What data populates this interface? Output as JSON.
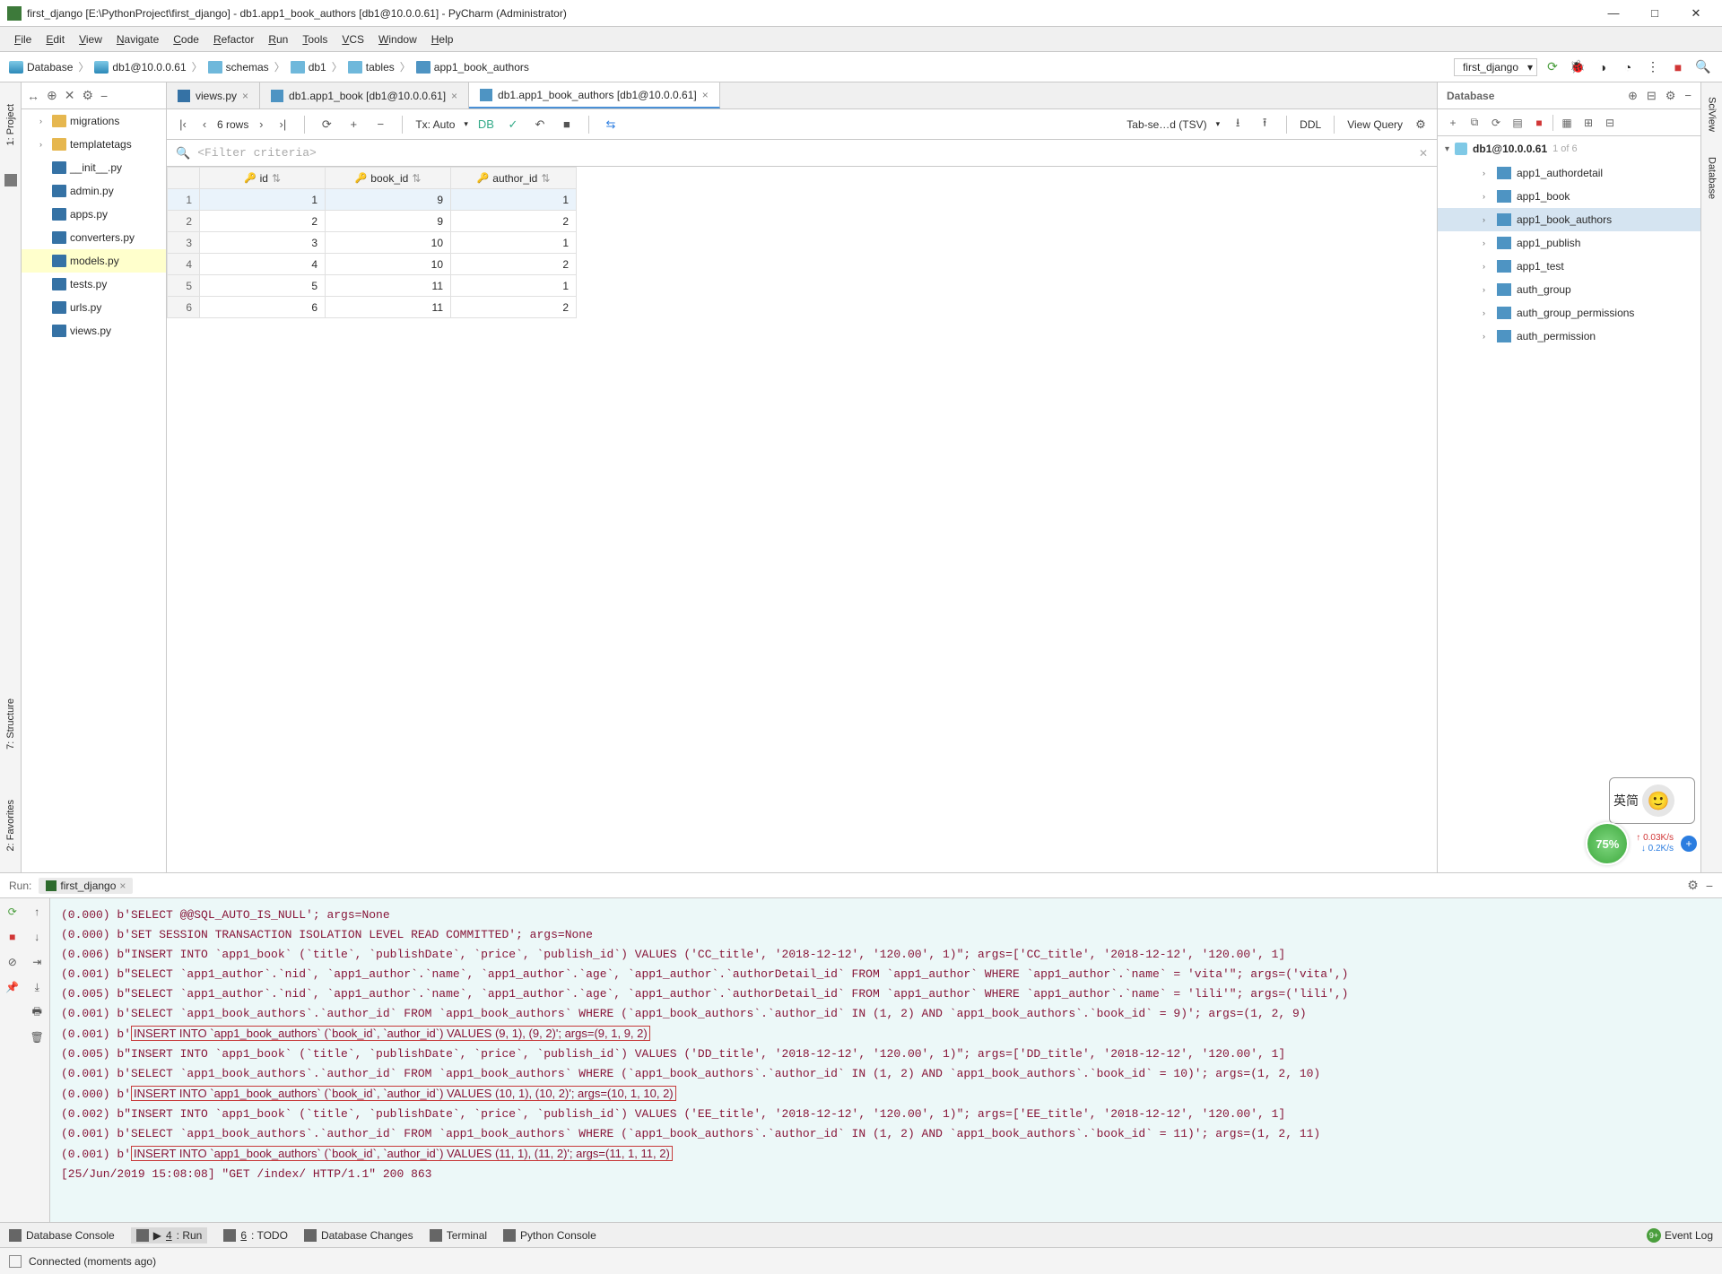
{
  "title": "first_django [E:\\PythonProject\\first_django] - db1.app1_book_authors [db1@10.0.0.61] - PyCharm (Administrator)",
  "menu": [
    "File",
    "Edit",
    "View",
    "Navigate",
    "Code",
    "Refactor",
    "Run",
    "Tools",
    "VCS",
    "Window",
    "Help"
  ],
  "breadcrumb": {
    "items": [
      "Database",
      "db1@10.0.0.61",
      "schemas",
      "db1",
      "tables",
      "app1_book_authors"
    ],
    "run_config": "first_django"
  },
  "left_tools": [
    "1: Project"
  ],
  "side_tools": [
    "2: Favorites",
    "7: Structure"
  ],
  "right_tools": [
    "SciView",
    "Database"
  ],
  "project_toolbar": [
    "↔",
    "⊕",
    "✕",
    "⚙",
    "−"
  ],
  "project_files": [
    {
      "name": "migrations",
      "kind": "folder"
    },
    {
      "name": "templatetags",
      "kind": "folder"
    },
    {
      "name": "__init__.py",
      "kind": "py"
    },
    {
      "name": "admin.py",
      "kind": "py"
    },
    {
      "name": "apps.py",
      "kind": "py"
    },
    {
      "name": "converters.py",
      "kind": "py"
    },
    {
      "name": "models.py",
      "kind": "py",
      "sel": true
    },
    {
      "name": "tests.py",
      "kind": "py"
    },
    {
      "name": "urls.py",
      "kind": "py"
    },
    {
      "name": "views.py",
      "kind": "py"
    }
  ],
  "editor_tabs": [
    {
      "label": "views.py",
      "icon": "py"
    },
    {
      "label": "db1.app1_book [db1@10.0.0.61]",
      "icon": "tbl"
    },
    {
      "label": "db1.app1_book_authors [db1@10.0.0.61]",
      "icon": "tbl",
      "active": true
    }
  ],
  "grid_toolbar": {
    "rows": "6 rows",
    "tx": "Tx: Auto",
    "format": "Tab-se…d (TSV)",
    "ddl": "DDL",
    "view_query": "View Query"
  },
  "filter_placeholder": "<Filter criteria>",
  "columns": [
    "id",
    "book_id",
    "author_id"
  ],
  "rows": [
    [
      1,
      9,
      1
    ],
    [
      2,
      9,
      2
    ],
    [
      3,
      10,
      1
    ],
    [
      4,
      10,
      2
    ],
    [
      5,
      11,
      1
    ],
    [
      6,
      11,
      2
    ]
  ],
  "db_panel": {
    "title": "Database",
    "datasource": "db1@10.0.0.61",
    "count": "1 of 6",
    "tables": [
      "app1_authordetail",
      "app1_book",
      "app1_book_authors",
      "app1_publish",
      "app1_test",
      "auth_group",
      "auth_group_permissions",
      "auth_permission"
    ],
    "selected": "app1_book_authors"
  },
  "run_panel": {
    "label": "Run:",
    "config": "first_django",
    "lines": [
      "(0.000) b'SELECT @@SQL_AUTO_IS_NULL'; args=None",
      "(0.000) b'SET SESSION TRANSACTION ISOLATION LEVEL READ COMMITTED'; args=None",
      "(0.006) b\"INSERT INTO `app1_book` (`title`, `publishDate`, `price`, `publish_id`) VALUES ('CC_title', '2018-12-12', '120.00', 1)\"; args=['CC_title', '2018-12-12', '120.00', 1]",
      "(0.001) b\"SELECT `app1_author`.`nid`, `app1_author`.`name`, `app1_author`.`age`, `app1_author`.`authorDetail_id` FROM `app1_author` WHERE `app1_author`.`name` = 'vita'\"; args=('vita',)",
      "(0.005) b\"SELECT `app1_author`.`nid`, `app1_author`.`name`, `app1_author`.`age`, `app1_author`.`authorDetail_id` FROM `app1_author` WHERE `app1_author`.`name` = 'lili'\"; args=('lili',)",
      "(0.001) b'SELECT `app1_book_authors`.`author_id` FROM `app1_book_authors` WHERE (`app1_book_authors`.`author_id` IN (1, 2) AND `app1_book_authors`.`book_id` = 9)'; args=(1, 2, 9)",
      "(0.001) b'INSERT INTO `app1_book_authors` (`book_id`, `author_id`) VALUES (9, 1), (9, 2)'; args=(9, 1, 9, 2)",
      "(0.005) b\"INSERT INTO `app1_book` (`title`, `publishDate`, `price`, `publish_id`) VALUES ('DD_title', '2018-12-12', '120.00', 1)\"; args=['DD_title', '2018-12-12', '120.00', 1]",
      "(0.001) b'SELECT `app1_book_authors`.`author_id` FROM `app1_book_authors` WHERE (`app1_book_authors`.`author_id` IN (1, 2) AND `app1_book_authors`.`book_id` = 10)'; args=(1, 2, 10)",
      "(0.000) b'INSERT INTO `app1_book_authors` (`book_id`, `author_id`) VALUES (10, 1), (10, 2)'; args=(10, 1, 10, 2)",
      "(0.002) b\"INSERT INTO `app1_book` (`title`, `publishDate`, `price`, `publish_id`) VALUES ('EE_title', '2018-12-12', '120.00', 1)\"; args=['EE_title', '2018-12-12', '120.00', 1]",
      "(0.001) b'SELECT `app1_book_authors`.`author_id` FROM `app1_book_authors` WHERE (`app1_book_authors`.`author_id` IN (1, 2) AND `app1_book_authors`.`book_id` = 11)'; args=(1, 2, 11)",
      "(0.001) b'INSERT INTO `app1_book_authors` (`book_id`, `author_id`) VALUES (11, 1), (11, 2)'; args=(11, 1, 11, 2)",
      "[25/Jun/2019 15:08:08] \"GET /index/ HTTP/1.1\" 200 863"
    ],
    "boxed": [
      6,
      9,
      12
    ]
  },
  "bottom_bar": {
    "items": [
      {
        "icon": "db",
        "label": "Database Console"
      },
      {
        "icon": "run",
        "label": "4: Run",
        "active": true,
        "u": "4"
      },
      {
        "icon": "todo",
        "label": "6: TODO",
        "u": "6"
      },
      {
        "icon": "db",
        "label": "Database Changes"
      },
      {
        "icon": "term",
        "label": "Terminal"
      },
      {
        "icon": "py",
        "label": "Python Console"
      }
    ],
    "event_log": "Event Log",
    "badge": "9+"
  },
  "status": "Connected (moments ago)",
  "floating": {
    "pct": "75%",
    "up": "0.03K/s",
    "down": "0.2K/s",
    "pill": "英简"
  }
}
